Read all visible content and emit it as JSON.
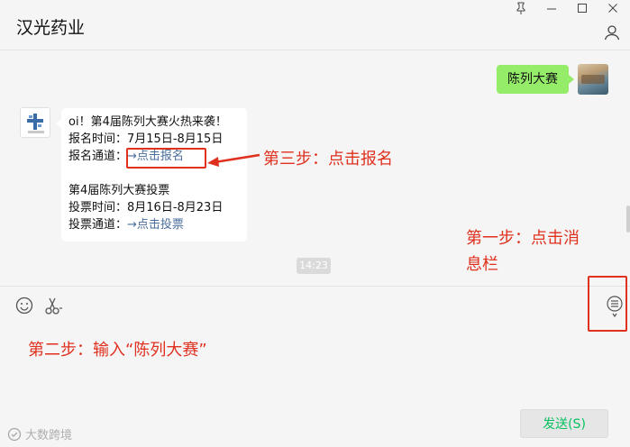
{
  "window": {
    "title": "汉光药业",
    "controls": {
      "pin": "⊥",
      "minimize": "—",
      "maximize": "☐",
      "close": "✕"
    }
  },
  "chat": {
    "right_message": "陈列大赛",
    "left_message": {
      "line1": "oi！第4届陈列大赛火热来袭！",
      "line2": "报名时间：7月15日-8月15日",
      "line3_prefix": "报名通道：",
      "line3_link": "→点击报名",
      "line4": "第4届陈列大赛投票",
      "line5": "投票时间：8月16日-8月23日",
      "line6_prefix": "投票通道：",
      "line6_link": "→点击投票"
    },
    "timestamp": "14:23"
  },
  "annotations": {
    "step1_line1": "第一步：点击消",
    "step1_line2": "息栏",
    "step2": "第二步：输入“陈列大赛”",
    "step3": "第三步：点击报名",
    "color": "#e0301e"
  },
  "input": {
    "send_label": "发送(S)"
  },
  "watermark": "大数跨境",
  "icons": [
    "pin-icon",
    "minimize-icon",
    "maximize-icon",
    "close-icon",
    "user-icon",
    "emoji-icon",
    "scissors-icon",
    "message-bar-icon"
  ]
}
